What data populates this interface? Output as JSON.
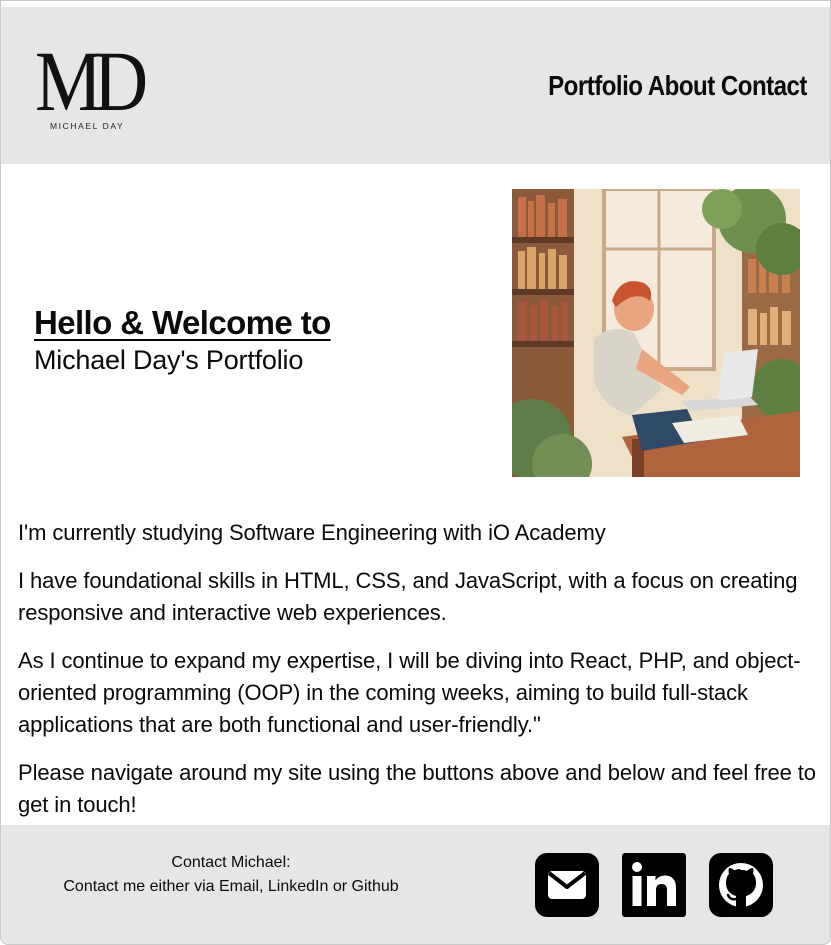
{
  "logo": {
    "monogram": "MD",
    "subtitle": "MICHAEL DAY"
  },
  "nav": {
    "portfolio": "Portfolio",
    "about": "About",
    "contact": "Contact"
  },
  "hero": {
    "title": "Hello & Welcome to",
    "subtitle": "Michael Day's Portfolio"
  },
  "intro": {
    "p1": "I'm currently studying Software Engineering with iO Academy",
    "p2": "I have foundational skills in HTML, CSS, and JavaScript, with a focus on creating responsive and interactive web experiences.",
    "p3": "As I continue to expand my expertise, I will be diving into React, PHP, and object-oriented programming (OOP) in the coming weeks, aiming to build full-stack applications that are both functional and user-friendly.\"",
    "p4": "Please navigate around my site using the buttons above and below and feel free to get in touch!"
  },
  "footer": {
    "contact_heading": "Contact Michael:",
    "contact_text": "Contact me either via Email, LinkedIn or Github",
    "icons": [
      "email-icon",
      "linkedin-icon",
      "github-icon"
    ]
  },
  "colors": {
    "header_bg": "#e6e6e5",
    "footer_bg": "#e6e6e5",
    "text": "#0a0a0a"
  }
}
